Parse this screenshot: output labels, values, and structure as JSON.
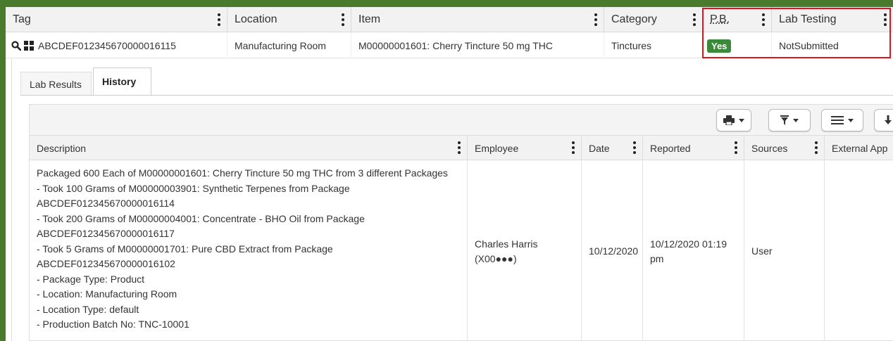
{
  "grid": {
    "columns": [
      "Tag",
      "Location",
      "Item",
      "Category",
      "P.B.",
      "Lab Testing"
    ],
    "row": {
      "tag": "ABCDEF012345670000016115",
      "location": "Manufacturing Room",
      "item": "M00000001601: Cherry Tincture 50 mg THC",
      "category": "Tinctures",
      "pb": "Yes",
      "lab_testing": "NotSubmitted"
    }
  },
  "tabs": [
    {
      "label": "Lab Results",
      "active": false
    },
    {
      "label": "History",
      "active": true
    }
  ],
  "history": {
    "columns": [
      "Description",
      "Employee",
      "Date",
      "Reported",
      "Sources",
      "External App"
    ],
    "row": {
      "description": [
        "Packaged 600 Each of M00000001601: Cherry Tincture 50 mg THC from 3 different Packages",
        "- Took 100 Grams of M00000003901: Synthetic Terpenes from Package",
        "ABCDEF012345670000016114",
        "- Took 200 Grams of M00000004001: Concentrate - BHO Oil from Package",
        "ABCDEF012345670000016117",
        "- Took 5 Grams of M00000001701: Pure CBD Extract from Package",
        "ABCDEF012345670000016102",
        "- Package Type: Product",
        "- Location: Manufacturing Room",
        "- Location Type: default",
        "- Production Batch No: TNC-10001"
      ],
      "employee_name": "Charles Harris",
      "employee_id": "(X00●●●)",
      "date": "10/12/2020",
      "reported_line1": "10/12/2020 01:19",
      "reported_line2": "pm",
      "sources": "User",
      "external_app": ""
    }
  },
  "colors": {
    "frame_green": "#4a7a2c",
    "badge_green": "#3b8a3a",
    "highlight_red": "#e1141b"
  },
  "icons": [
    "search-icon",
    "grid-icon",
    "print-icon",
    "filter-icon",
    "menu-icon",
    "download-icon",
    "kebab-icon",
    "caret-down-icon"
  ]
}
